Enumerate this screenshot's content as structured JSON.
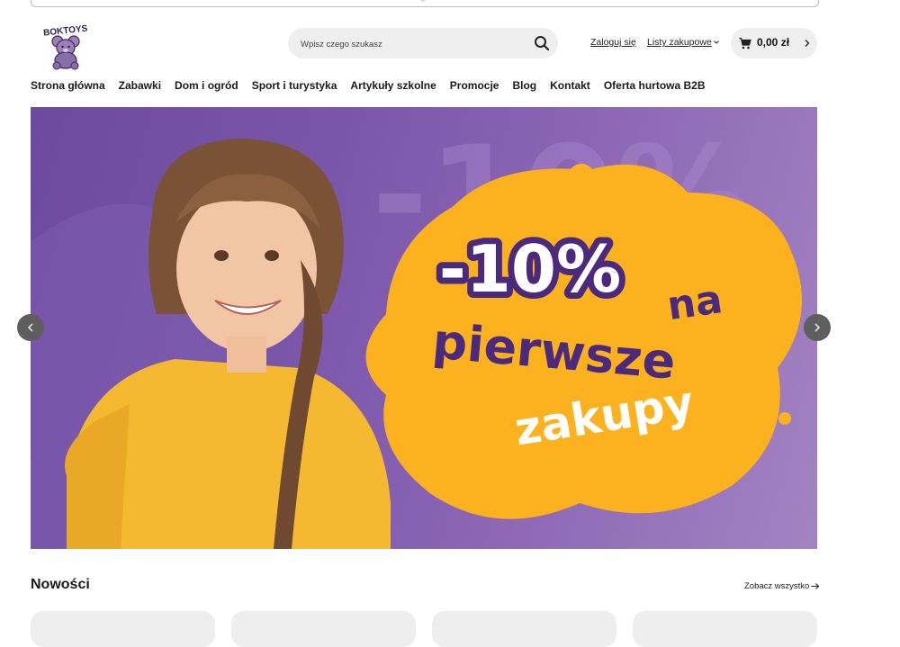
{
  "header": {
    "logo_text": "BOKTOYS",
    "search": {
      "placeholder": "Wpisz czego szukasz"
    },
    "login_label": "Zaloguj się",
    "lists_label": "Listy zakupowe",
    "cart_amount": "0,00 zł"
  },
  "nav": {
    "items": [
      {
        "label": "Strona główna"
      },
      {
        "label": "Zabawki"
      },
      {
        "label": "Dom i ogród"
      },
      {
        "label": "Sport i turystyka"
      },
      {
        "label": "Artykuły szkolne"
      },
      {
        "label": "Promocje"
      },
      {
        "label": "Blog"
      },
      {
        "label": "Kontakt"
      },
      {
        "label": "Oferta hurtowa B2B"
      }
    ]
  },
  "hero": {
    "line1": "-10%",
    "line2": "na",
    "line3": "pierwsze",
    "line4": "zakupy",
    "bg_text": "-10%",
    "colors": {
      "purple": "#7a56aa",
      "yellow": "#fbb21e",
      "dark_purple": "#4b2a7d"
    }
  },
  "section": {
    "title": "Nowości",
    "see_all_label": "Zobacz wszystko"
  },
  "icons": {
    "search": "search-icon",
    "cart": "cart-icon",
    "chevron": "chevron-down-icon",
    "arrow": "arrow-right-icon"
  }
}
